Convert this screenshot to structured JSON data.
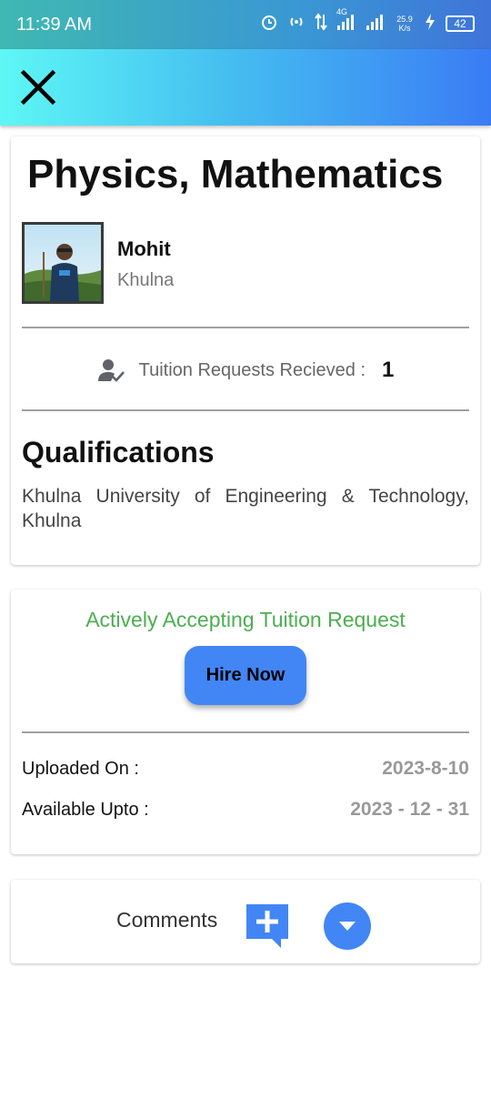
{
  "status_bar": {
    "time": "11:39 AM",
    "network": "4G",
    "speed": "25.9 K/s",
    "battery": "42"
  },
  "app_bar": {
    "close_icon": "close-icon"
  },
  "profile": {
    "subjects": "Physics, Mathematics",
    "tutor_name": "Mohit",
    "tutor_location": "Khulna",
    "requests_label": "Tuition Requests Recieved :",
    "requests_count": "1",
    "qualifications_title": "Qualifications",
    "qualifications_text": "Khulna University of Engineering & Technology, Khulna"
  },
  "hire": {
    "status_text": "Actively Accepting Tuition Request",
    "status_color": "#4caf50",
    "button_label": "Hire Now",
    "button_color": "#4286f5",
    "uploaded_label": "Uploaded On :",
    "uploaded_value": "2023-8-10",
    "available_label": "Available Upto :",
    "available_value": "2023 - 12 - 31"
  },
  "comments": {
    "label": "Comments",
    "add_icon": "add-comment-icon",
    "expand_icon": "chevron-down-icon"
  }
}
